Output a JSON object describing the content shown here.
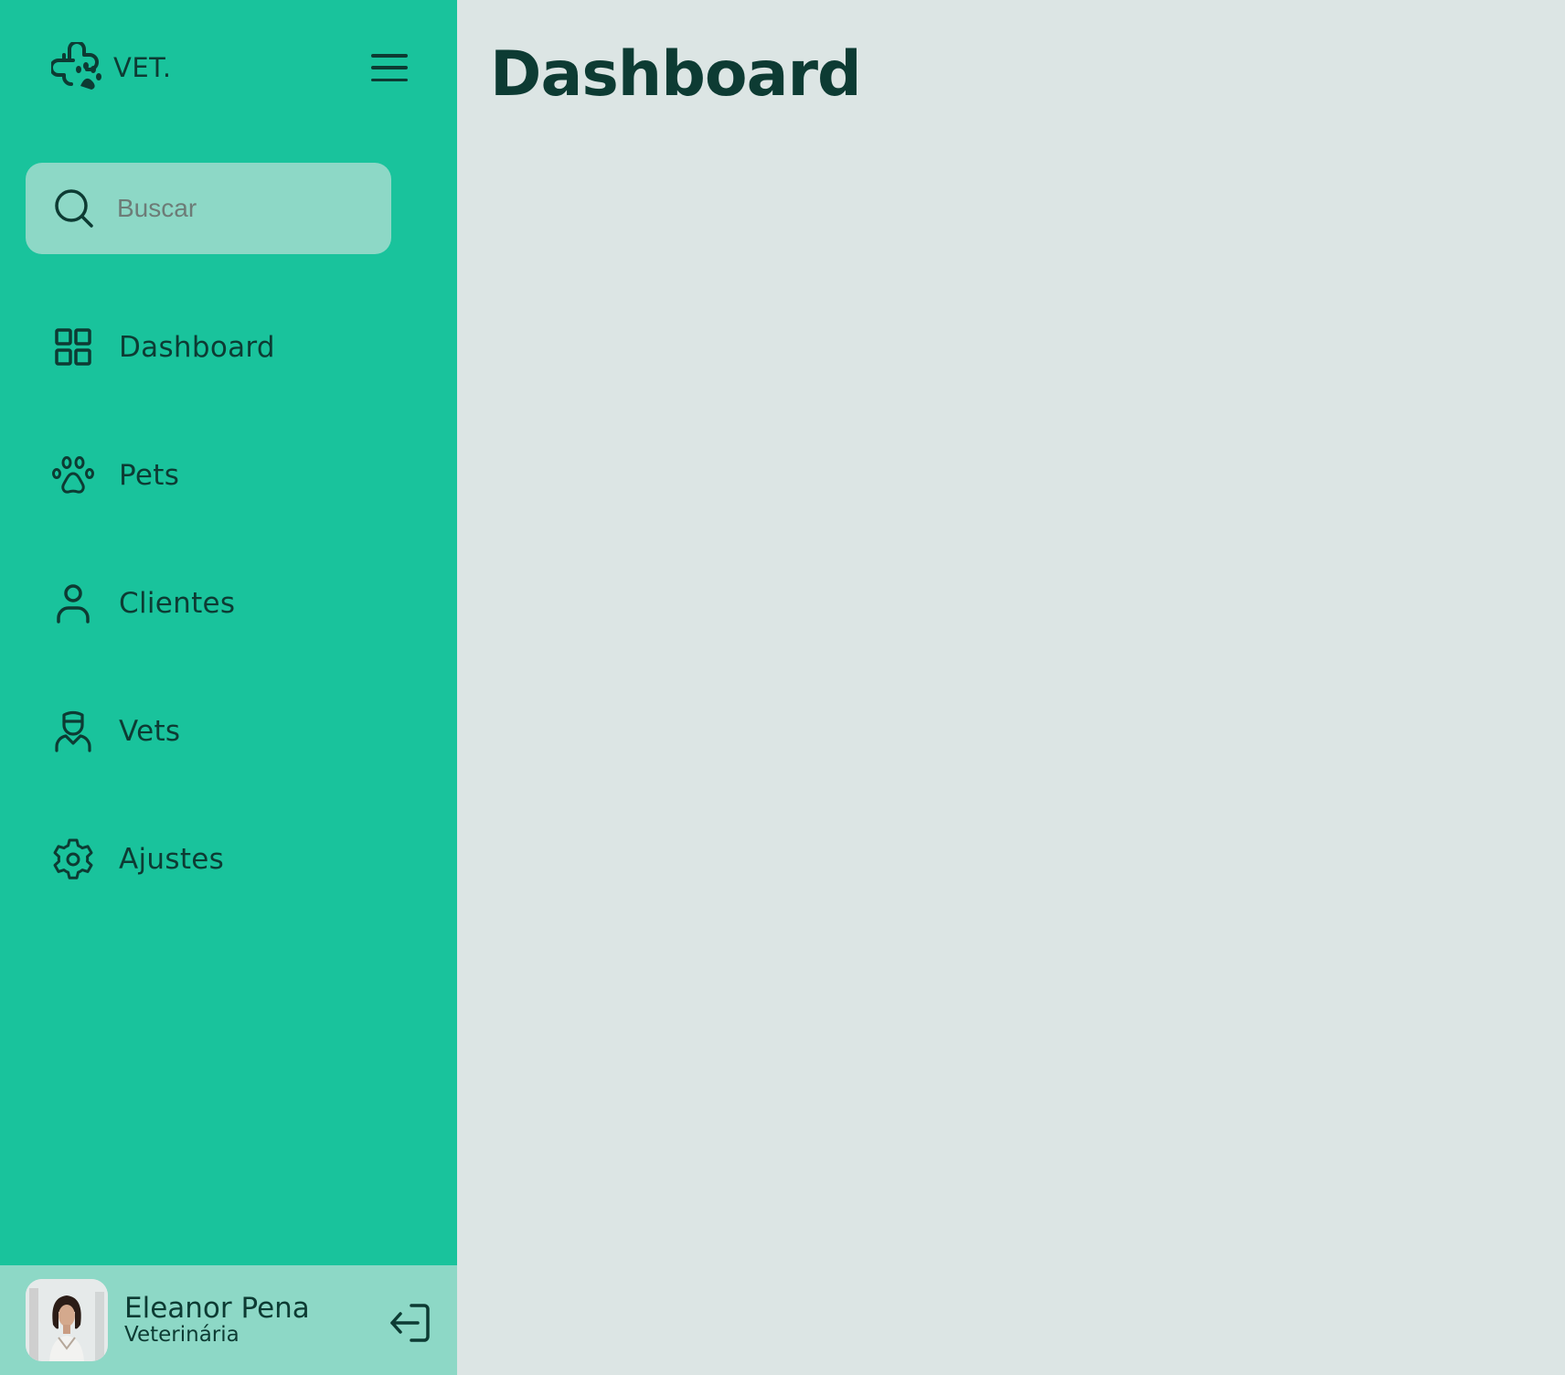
{
  "brand": {
    "name": "VET.",
    "logo_icon": "paw-clover-logo"
  },
  "menu": {
    "icon": "hamburger-menu-icon"
  },
  "search": {
    "placeholder": "Buscar",
    "value": "",
    "icon": "search-icon"
  },
  "nav": {
    "items": [
      {
        "label": "Dashboard",
        "icon": "grid-icon"
      },
      {
        "label": "Pets",
        "icon": "paw-icon"
      },
      {
        "label": "Clientes",
        "icon": "user-icon"
      },
      {
        "label": "Vets",
        "icon": "vet-icon"
      },
      {
        "label": "Ajustes",
        "icon": "gear-icon"
      }
    ]
  },
  "profile": {
    "name": "Eleanor Pena",
    "role": "Veterinária",
    "logout_icon": "logout-icon"
  },
  "main": {
    "title": "Dashboard"
  },
  "colors": {
    "sidebar": "#19c39c",
    "sidebar_light": "#8dd8c6",
    "background": "#dce5e4",
    "text_dark": "#0d3b33"
  }
}
